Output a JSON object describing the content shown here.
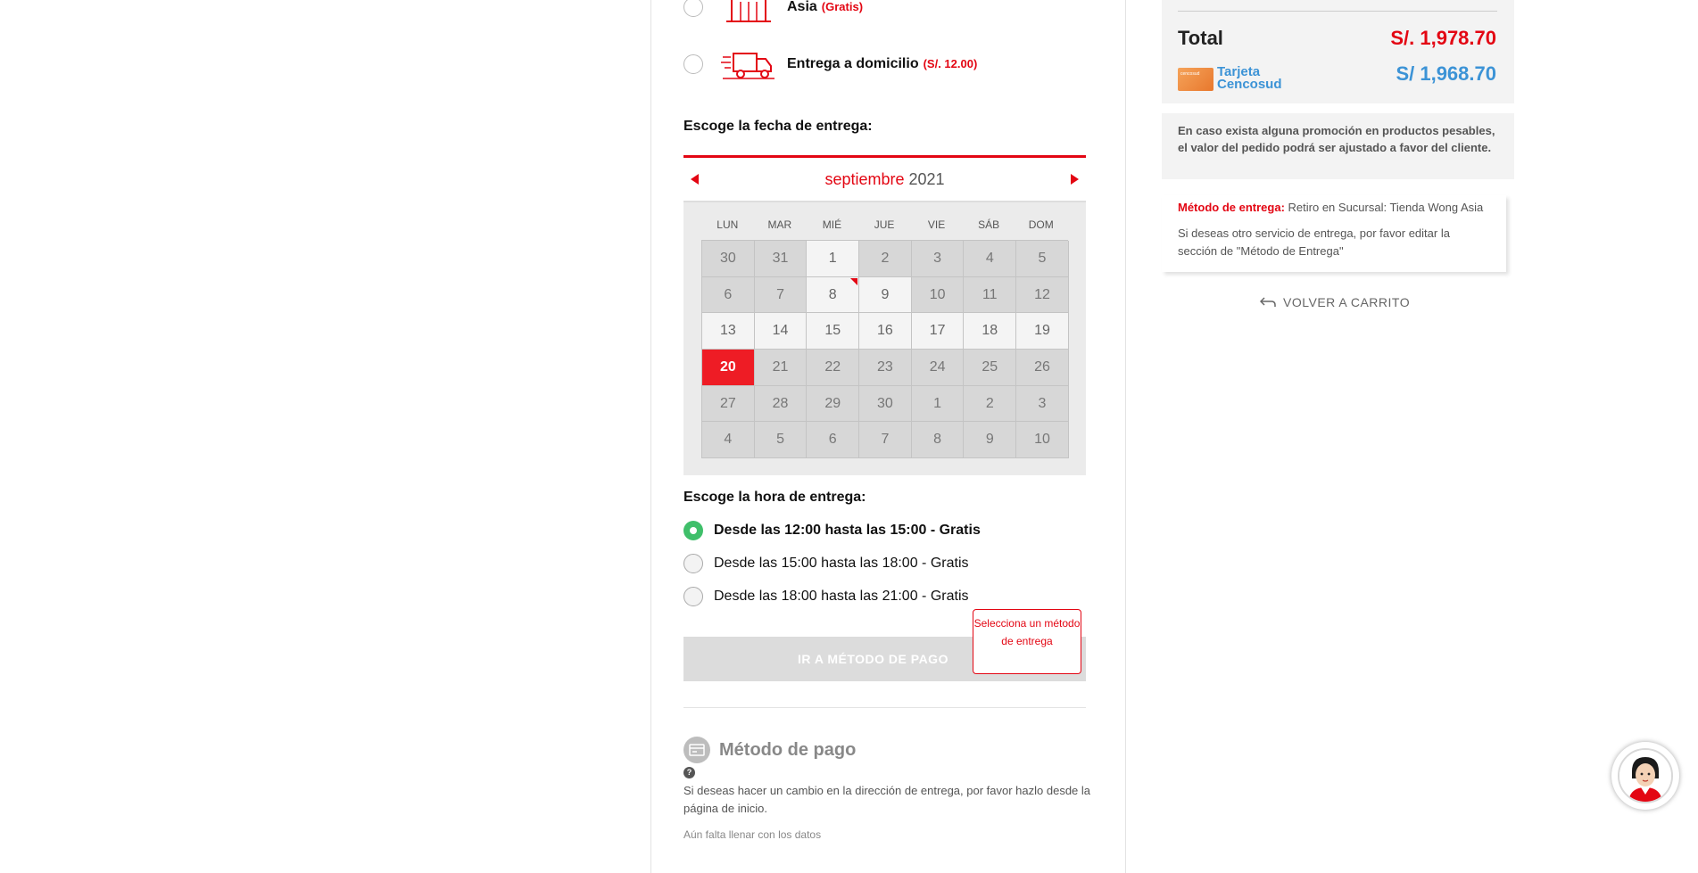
{
  "delivery_options": [
    {
      "label": "Asia",
      "price": "(Gratis)"
    },
    {
      "label": "Entrega a domicilio",
      "price": "(S/. 12.00)"
    }
  ],
  "date_section": {
    "title": "Escoge la fecha de entrega:"
  },
  "calendar": {
    "month": "septiembre",
    "year": "2021",
    "weekdays": [
      "LUN",
      "MAR",
      "MIÉ",
      "JUE",
      "VIE",
      "SÁB",
      "DOM"
    ],
    "days": [
      [
        "30",
        "31",
        "1",
        "2",
        "3",
        "4",
        "5"
      ],
      [
        "6",
        "7",
        "8",
        "9",
        "10",
        "11",
        "12"
      ],
      [
        "13",
        "14",
        "15",
        "16",
        "17",
        "18",
        "19"
      ],
      [
        "20",
        "21",
        "22",
        "23",
        "24",
        "25",
        "26"
      ],
      [
        "27",
        "28",
        "29",
        "30",
        "1",
        "2",
        "3"
      ],
      [
        "4",
        "5",
        "6",
        "7",
        "8",
        "9",
        "10"
      ]
    ],
    "selected_day": "20",
    "marked_day": "8"
  },
  "time_section": {
    "title": "Escoge la hora de entrega:"
  },
  "time_slots": [
    {
      "label": "Desde las 12:00 hasta las 15:00 - Gratis",
      "selected": true
    },
    {
      "label": "Desde las 15:00 hasta las 18:00 - Gratis",
      "selected": false
    },
    {
      "label": "Desde las 18:00 hasta las 21:00 - Gratis",
      "selected": false
    }
  ],
  "continue_button": {
    "label": "IR A MÉTODO DE PAGO"
  },
  "tooltip": {
    "text": "Selecciona un método de entrega"
  },
  "payment_method": {
    "title": "Método de pago",
    "help_icon": "?",
    "note": "Si deseas hacer un cambio en la dirección de entrega, por favor hazlo desde la página de inicio.",
    "pending": "Aún falta llenar con los datos"
  },
  "summary": {
    "total_label": "Total",
    "total_value": "S/. 1,978.70",
    "card_label": "Tarjeta Cencosud",
    "card_value": "S/ 1,968.70",
    "card_logo_text": "cencosud"
  },
  "promo_note": "En caso exista alguna promoción en productos pesables, el valor del pedido podrá ser ajustado a favor del cliente.",
  "delivery_method": {
    "label": "Método de entrega:",
    "value": "Retiro en Sucursal: Tienda Wong Asia",
    "note": "Si deseas otro servicio de entrega, por favor editar la sección de \"Método de Entrega\""
  },
  "back_link": {
    "label": "VOLVER A CARRITO"
  },
  "colors": {
    "accent": "#e30613",
    "selected_day": "#ee1c25",
    "radio_selected": "#3fbf6a",
    "card_blue": "#3c93d6"
  }
}
